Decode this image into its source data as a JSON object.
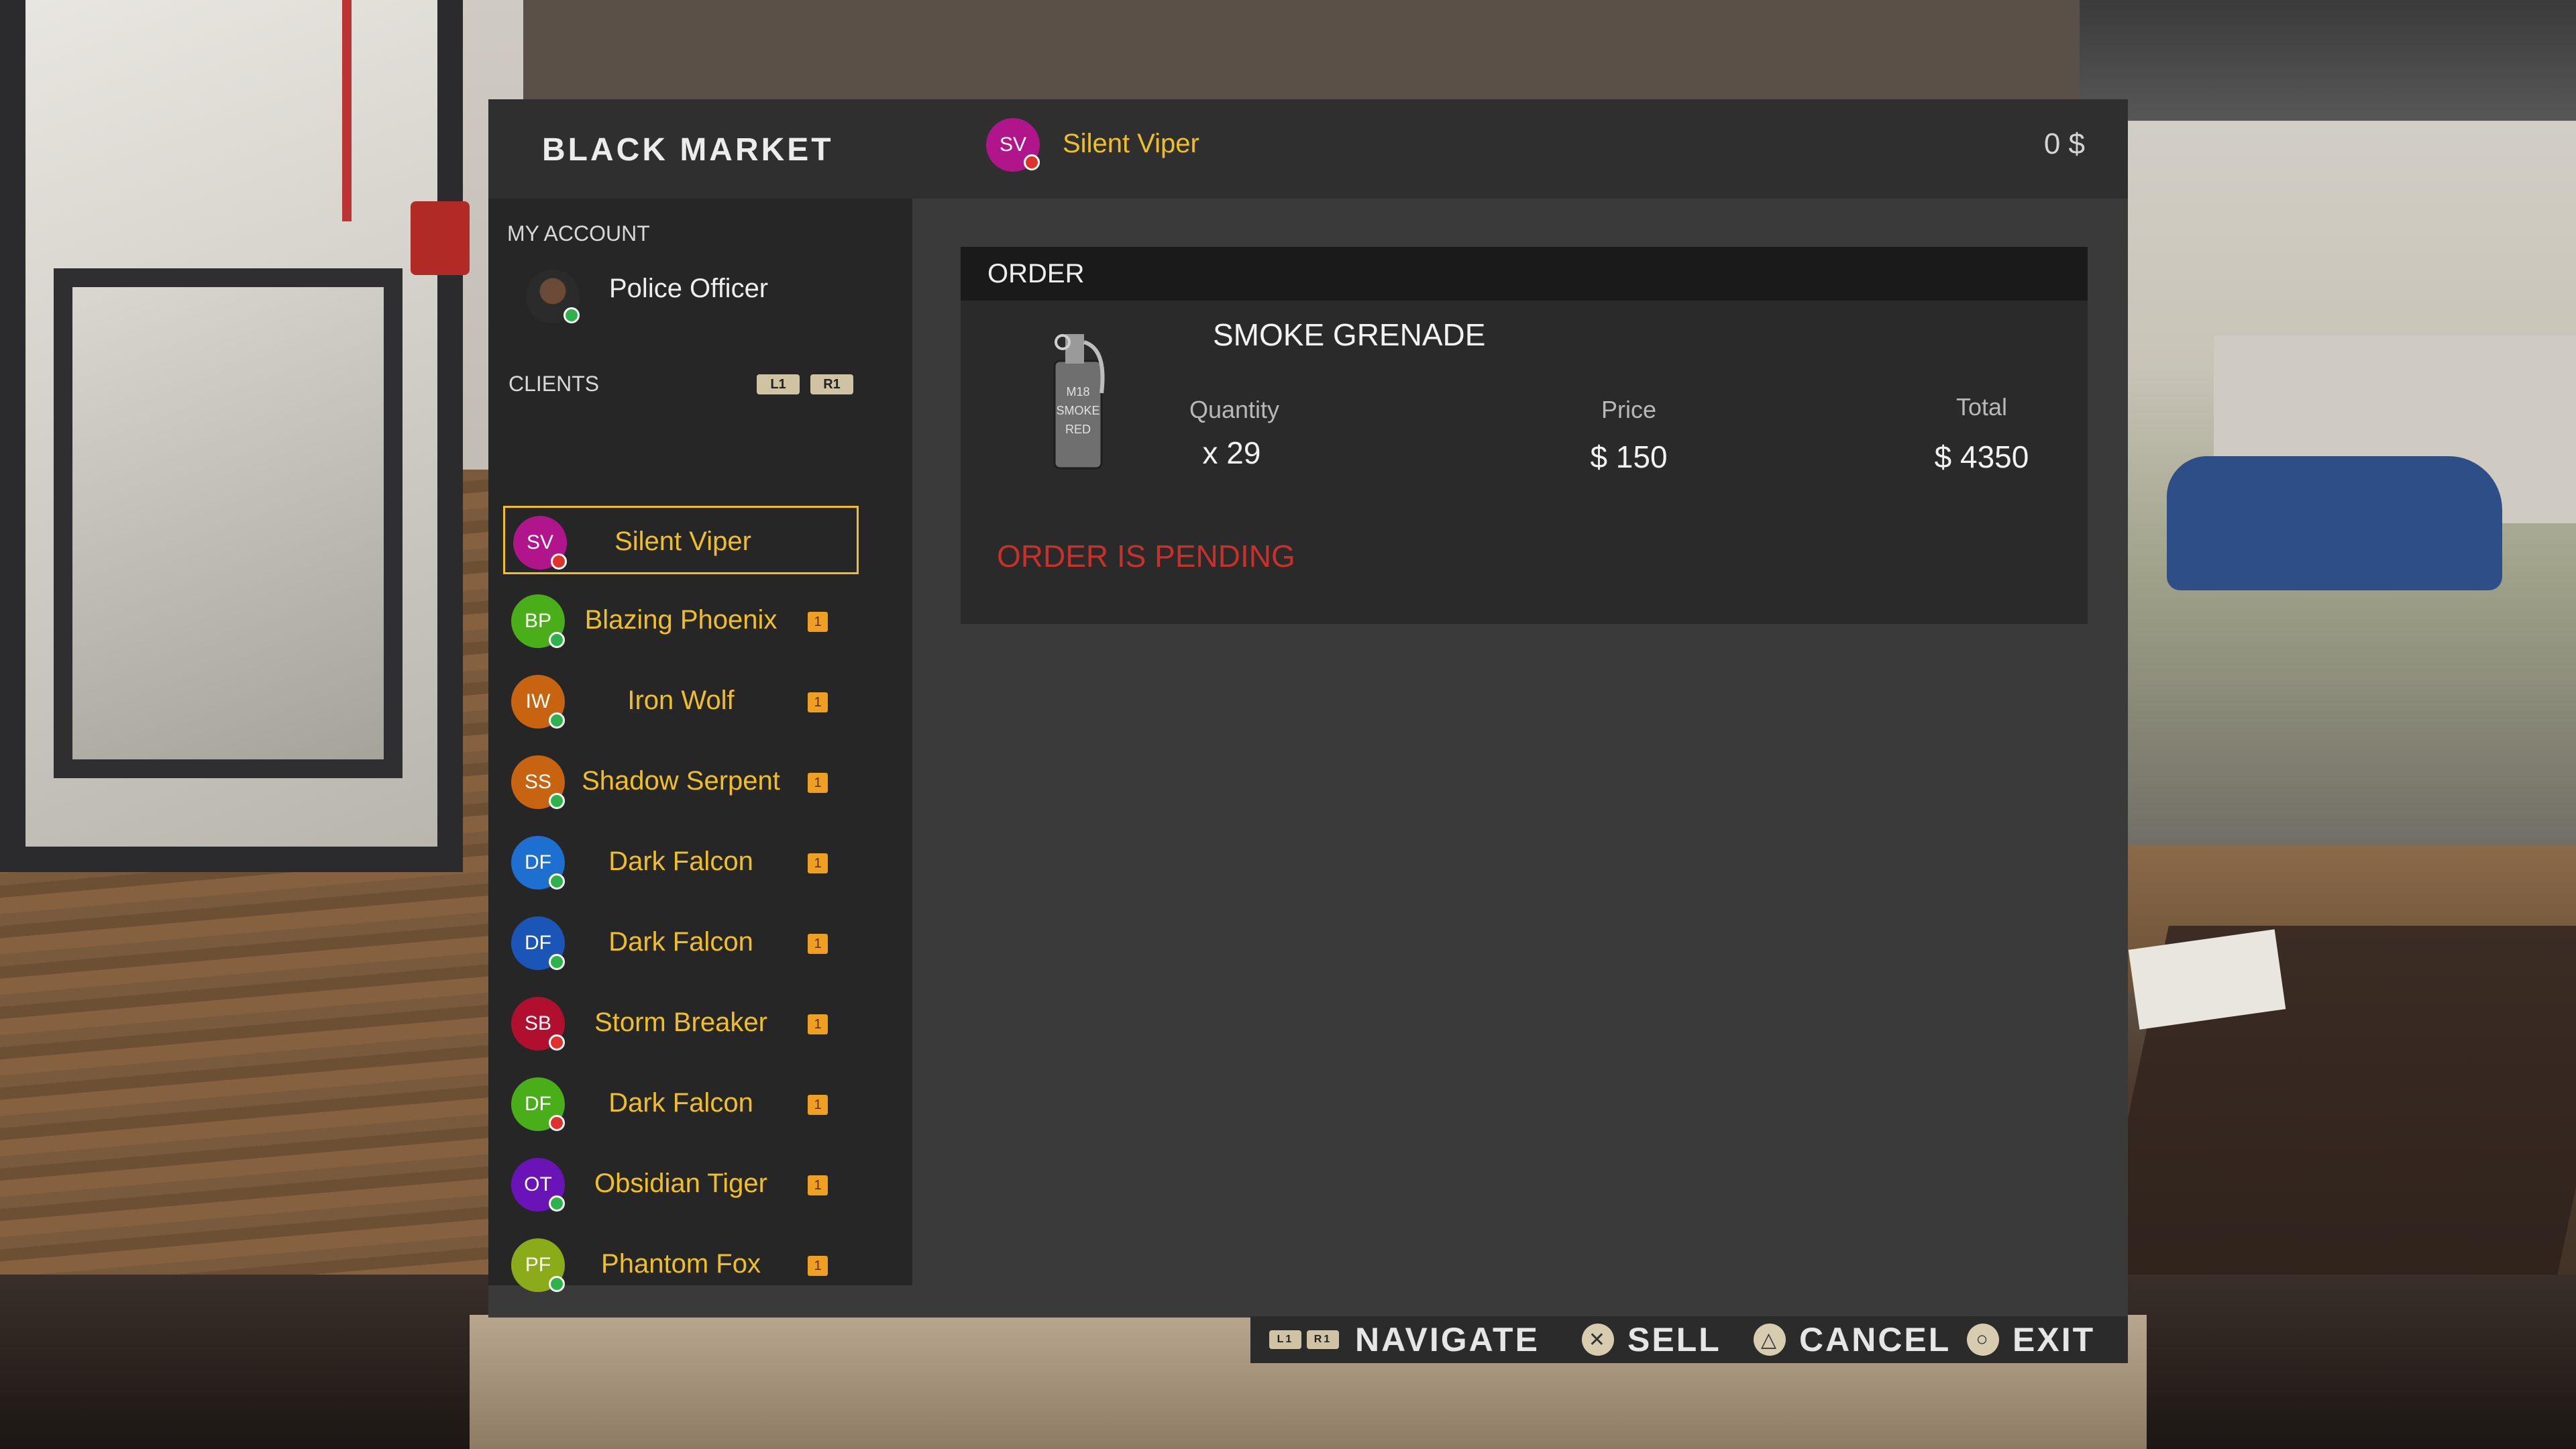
{
  "app": {
    "title": "BLACK MARKET",
    "balance": "0 $"
  },
  "header_user": {
    "initials": "SV",
    "name": "Silent Viper",
    "color": "#b0158c",
    "status": "red"
  },
  "account": {
    "section_label": "MY ACCOUNT",
    "name": "Police Officer",
    "status": "green"
  },
  "clients_section": {
    "label": "CLIENTS",
    "prev_button": "L1",
    "next_button": "R1"
  },
  "clients": [
    {
      "initials": "SV",
      "name": "Silent Viper",
      "color": "#b0158c",
      "status": "red",
      "badge": "",
      "selected": true
    },
    {
      "initials": "BP",
      "name": "Blazing Phoenix",
      "color": "#4aae18",
      "status": "green",
      "badge": "1"
    },
    {
      "initials": "IW",
      "name": "Iron Wolf",
      "color": "#c86410",
      "status": "green",
      "badge": "1"
    },
    {
      "initials": "SS",
      "name": "Shadow Serpent",
      "color": "#c86410",
      "status": "green",
      "badge": "1"
    },
    {
      "initials": "DF",
      "name": "Dark Falcon",
      "color": "#1d6fd0",
      "status": "green",
      "badge": "1"
    },
    {
      "initials": "DF",
      "name": "Dark Falcon",
      "color": "#1b55b8",
      "status": "green",
      "badge": "1"
    },
    {
      "initials": "SB",
      "name": "Storm Breaker",
      "color": "#b0102e",
      "status": "red",
      "badge": "1"
    },
    {
      "initials": "DF",
      "name": "Dark Falcon",
      "color": "#4aae18",
      "status": "red",
      "badge": "1"
    },
    {
      "initials": "OT",
      "name": "Obsidian Tiger",
      "color": "#6a14b8",
      "status": "green",
      "badge": "1"
    },
    {
      "initials": "PF",
      "name": "Phantom Fox",
      "color": "#8aac18",
      "status": "green",
      "badge": "1"
    }
  ],
  "order": {
    "header": "ORDER",
    "item_name": "SMOKE GRENADE",
    "item_label_lines": [
      "M18",
      "SMOKE",
      "RED"
    ],
    "quantity_label": "Quantity",
    "quantity_value": "x 29",
    "price_label": "Price",
    "price_value": "$ 150",
    "total_label": "Total",
    "total_value": "$ 4350",
    "status_text": "ORDER IS PENDING"
  },
  "footer": {
    "nav_l1": "L1",
    "nav_r1": "R1",
    "navigate": "NAVIGATE",
    "sell_icon": "✕",
    "sell": "SELL",
    "cancel_icon": "△",
    "cancel": "CANCEL",
    "exit_icon": "○",
    "exit": "EXIT"
  }
}
